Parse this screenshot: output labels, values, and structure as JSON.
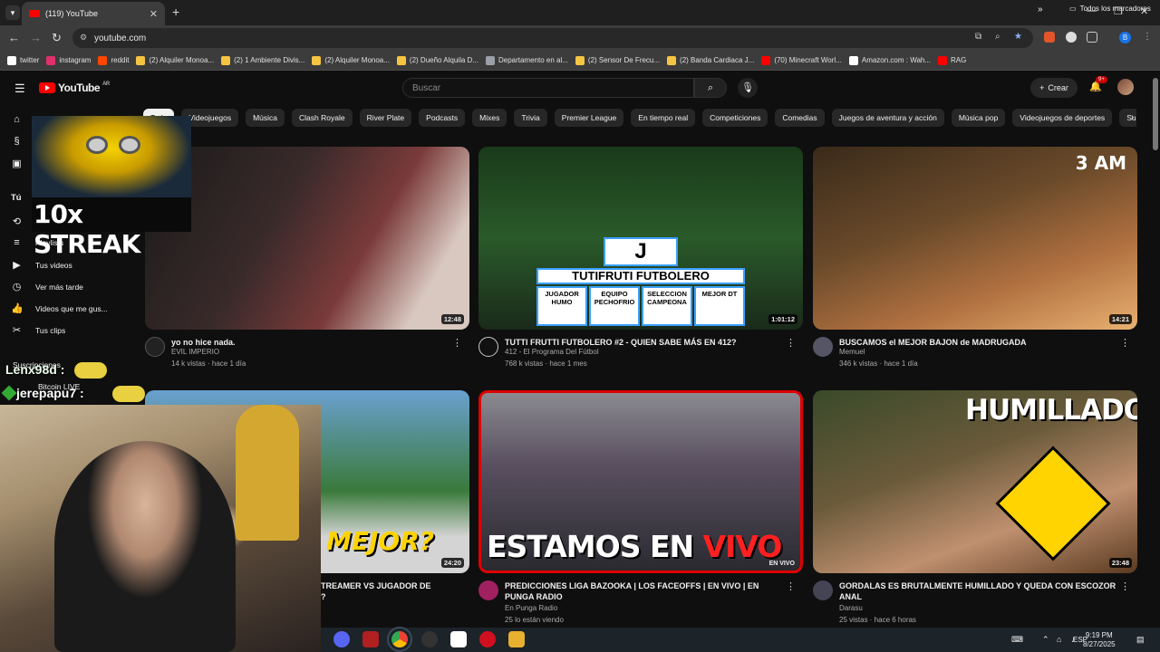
{
  "browser": {
    "tab_title": "(119) YouTube",
    "url": "youtube.com",
    "bookmarks": [
      {
        "label": "twitter",
        "color": "#ffffff"
      },
      {
        "label": "instagram",
        "color": "#e1306c"
      },
      {
        "label": "reddit",
        "color": "#ff4500"
      },
      {
        "label": "(2) Alquiler Monoa...",
        "color": "#f5c542"
      },
      {
        "label": "(2) 1 Ambiente Divis...",
        "color": "#f5c542"
      },
      {
        "label": "(2) Alquiler Monoa...",
        "color": "#f5c542"
      },
      {
        "label": "(2) Dueño Alquila D...",
        "color": "#f5c542"
      },
      {
        "label": "Departamento en al...",
        "color": "#9aa0a6"
      },
      {
        "label": "(2) Sensor De Frecu...",
        "color": "#f5c542"
      },
      {
        "label": "(2) Banda Cardiaca J...",
        "color": "#f5c542"
      },
      {
        "label": "(70) Minecraft Worl...",
        "color": "#ff0000"
      },
      {
        "label": "Amazon.com : Wah...",
        "color": "#ffffff"
      },
      {
        "label": "RAG",
        "color": "#ff0000"
      }
    ],
    "bookmarks_all": "Todos los marcadores"
  },
  "youtube": {
    "logo": "YouTube",
    "country": "AR",
    "search_placeholder": "Buscar",
    "create_label": "Crear",
    "notifications": "9+",
    "chips": [
      "Todo",
      "Videojuegos",
      "Música",
      "Clash Royale",
      "River Plate",
      "Podcasts",
      "Mixes",
      "Trivia",
      "Premier League",
      "En tiempo real",
      "Competiciones",
      "Comedias",
      "Juegos de aventura y acción",
      "Música pop",
      "Videojuegos de deportes",
      "Subidos re"
    ],
    "sidebar": {
      "section_you": "Tú",
      "items": [
        "Playlists",
        "Tus videos",
        "Ver más tarde",
        "Videos que me gus...",
        "Tus clips"
      ],
      "subscriptions": "Suscripciones",
      "sub_item": "Bitcoin LIVE"
    }
  },
  "overlay": {
    "streak": "10x STREAK",
    "chat": [
      "Lenx98d :",
      "jerepapu7 :"
    ]
  },
  "videos": [
    {
      "title": "yo no hice nada.",
      "channel": "EVIL IMPERIO",
      "stats": "14 k vistas · hace 1 día",
      "duration": "12:48"
    },
    {
      "title": "TUTTI FRUTTI FUTBOLERO #2 - QUIEN SABE MÁS EN 412?",
      "channel": "412 - El Programa Del Fútbol",
      "stats": "768 k vistas · hace 1 mes",
      "duration": "1:01:12",
      "thumb_letter": "J",
      "thumb_banner": "TUTIFRUTI FUTBOLERO",
      "thumb_cells": [
        "JUGADOR HUMO",
        "EQUIPO PECHOFRIO",
        "SELECCION CAMPEONA",
        "MEJOR DT"
      ]
    },
    {
      "title": "BUSCAMOS el MEJOR BAJON de MADRUGADA",
      "channel": "Memuel",
      "stats": "346 k vistas · hace 1 día",
      "duration": "14:21",
      "thumb_text": "3 AM"
    },
    {
      "title": "TREAMER VS JUGADOR DE",
      "title2": "?",
      "duration": "24:20",
      "thumb_text": "MEJOR?"
    },
    {
      "title": "PREDICCIONES LIGA BAZOOKA | LOS FACEOFFS | EN VIVO | EN PUNGA RADIO",
      "channel": "En Punga Radio",
      "stats": "25 lo están viendo",
      "thumb_text1": "ESTAMOS EN ",
      "thumb_text2": "VIVO",
      "live_badge": "EN VIVO"
    },
    {
      "title": "GORDALAS ES BRUTALMENTE HUMILLADO Y QUEDA CON ESCOZOR ANAL",
      "channel": "Darasu",
      "stats": "25 vistas · hace 6 horas",
      "duration": "23:48",
      "thumb_text": "HUMILLADO"
    }
  ],
  "taskbar": {
    "time": "9:19 PM",
    "date": "8/27/2025",
    "lang": "ESP"
  }
}
